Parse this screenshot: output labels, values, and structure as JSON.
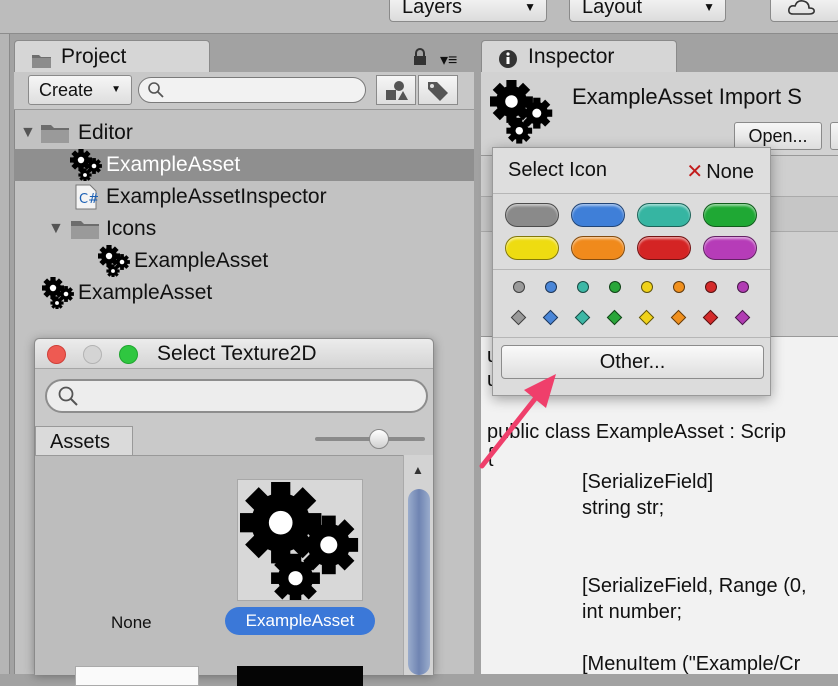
{
  "toolbar": {
    "layers_label": "Layers",
    "layout_label": "Layout"
  },
  "project": {
    "tab_label": "Project",
    "create_label": "Create",
    "tree": [
      {
        "label": "Editor",
        "icon": "folder-icon",
        "type": "folder"
      },
      {
        "label": "ExampleAsset",
        "icon": "gears-icon",
        "type": "asset",
        "selected": true
      },
      {
        "label": "ExampleAssetInspector",
        "icon": "csharp-script-icon",
        "type": "script"
      },
      {
        "label": "Icons",
        "icon": "folder-icon",
        "type": "folder"
      },
      {
        "label": "ExampleAsset",
        "icon": "gears-icon",
        "type": "asset"
      },
      {
        "label": "ExampleAsset",
        "icon": "gears-icon",
        "type": "asset"
      }
    ]
  },
  "inspector": {
    "tab_label": "Inspector",
    "title": "ExampleAsset Import S",
    "open_label": "Open...",
    "code": [
      "u",
      "u",
      "public class ExampleAsset : Scrip",
      "{",
      "[SerializeField]",
      "string str;",
      "[SerializeField, Range (0,",
      "int number;",
      "[MenuItem (\"Example/Cr"
    ]
  },
  "texture_window": {
    "title": "Select Texture2D",
    "tab_label": "Assets",
    "items": [
      {
        "label": "None"
      },
      {
        "label": "ExampleAsset",
        "selected": true
      }
    ]
  },
  "icon_popup": {
    "title": "Select Icon",
    "none_label": "None",
    "other_label": "Other...",
    "label_colors": [
      "#8a8a8a",
      "#3f7fd8",
      "#36b5a2",
      "#1fa834",
      "#eedc11",
      "#f08a1c",
      "#d42424",
      "#b63cb8"
    ],
    "dot_colors": [
      "#9a9a9a",
      "#4a86d8",
      "#3db8a6",
      "#2aa63a",
      "#f0d21a",
      "#f0901e",
      "#d42a2a",
      "#b13cb3"
    ]
  },
  "annotation": {
    "arrow_color": "#ef3f6b"
  },
  "colors": {
    "selection_blue": "#3b78d8",
    "tree_selection": "#8f8f8f"
  }
}
